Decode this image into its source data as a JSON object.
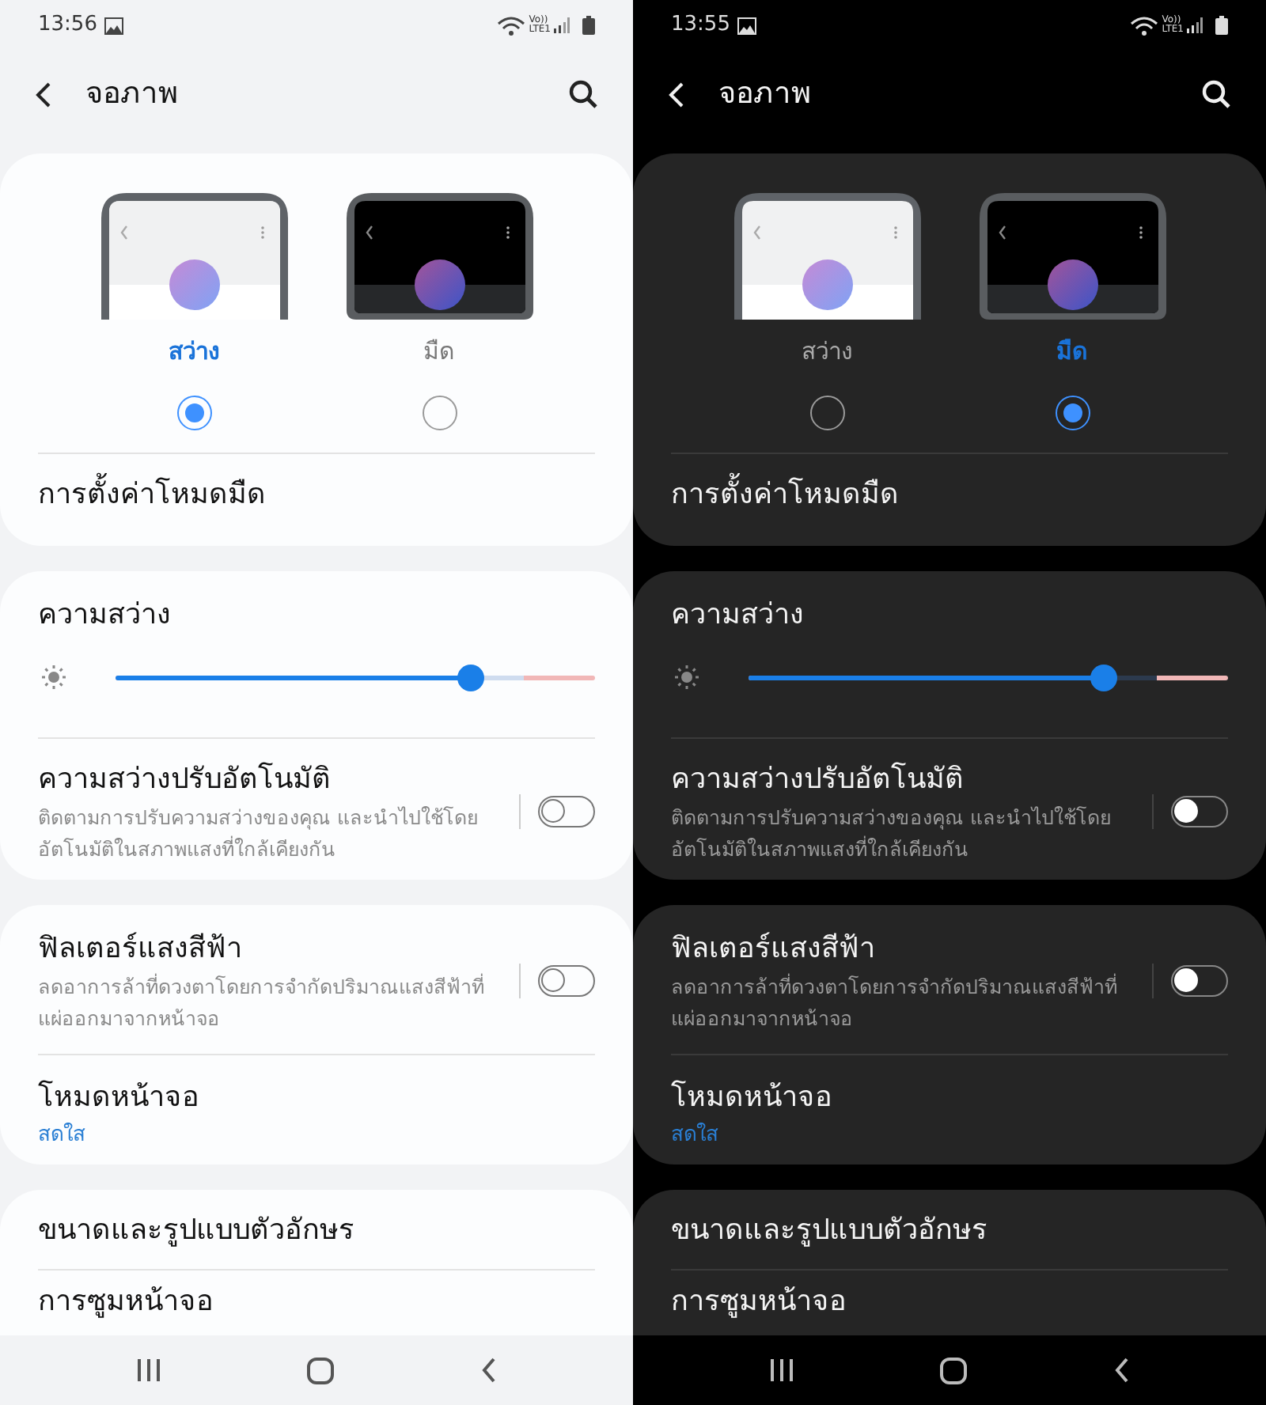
{
  "screens": [
    {
      "kind": "light",
      "status": {
        "time": "13:56",
        "network_top": "Vo))",
        "network_bottom": "LTE1"
      },
      "title": "จอภาพ",
      "theme_options": [
        {
          "kind": "light",
          "label": "สว่าง",
          "selected": true
        },
        {
          "kind": "dark",
          "label": "มืด",
          "selected": false
        }
      ],
      "dark_mode_settings": "การตั้งค่าโหมดมืด",
      "brightness": {
        "label": "ความสว่าง",
        "level": 0.74
      },
      "adaptive_brightness": {
        "title": "ความสว่างปรับอัตโนมัติ",
        "description": "ติดตามการปรับความสว่างของคุณ และนำไปใช้โดยอัตโนมัติในสภาพแสงที่ใกล้เคียงกัน",
        "on": false
      },
      "blue_light_filter": {
        "title": "ฟิลเตอร์แสงสีฟ้า",
        "description": "ลดอาการล้าที่ดวงตาโดยการจำกัดปริมาณแสงสีฟ้าที่แผ่ออกมาจากหน้าจอ",
        "on": false
      },
      "screen_mode": {
        "title": "โหมดหน้าจอ",
        "value": "สดใส"
      },
      "font_size": "ขนาดและรูปแบบตัวอักษร",
      "screen_zoom": "การซูมหน้าจอ"
    },
    {
      "kind": "dark",
      "status": {
        "time": "13:55",
        "network_top": "Vo))",
        "network_bottom": "LTE1"
      },
      "title": "จอภาพ",
      "theme_options": [
        {
          "kind": "light",
          "label": "สว่าง",
          "selected": false
        },
        {
          "kind": "dark",
          "label": "มืด",
          "selected": true
        }
      ],
      "dark_mode_settings": "การตั้งค่าโหมดมืด",
      "brightness": {
        "label": "ความสว่าง",
        "level": 0.74
      },
      "adaptive_brightness": {
        "title": "ความสว่างปรับอัตโนมัติ",
        "description": "ติดตามการปรับความสว่างของคุณ และนำไปใช้โดยอัตโนมัติในสภาพแสงที่ใกล้เคียงกัน",
        "on": false
      },
      "blue_light_filter": {
        "title": "ฟิลเตอร์แสงสีฟ้า",
        "description": "ลดอาการล้าที่ดวงตาโดยการจำกัดปริมาณแสงสีฟ้าที่แผ่ออกมาจากหน้าจอ",
        "on": false
      },
      "screen_mode": {
        "title": "โหมดหน้าจอ",
        "value": "สดใส"
      },
      "font_size": "ขนาดและรูปแบบตัวอักษร",
      "screen_zoom": "การซูมหน้าจอ"
    }
  ]
}
